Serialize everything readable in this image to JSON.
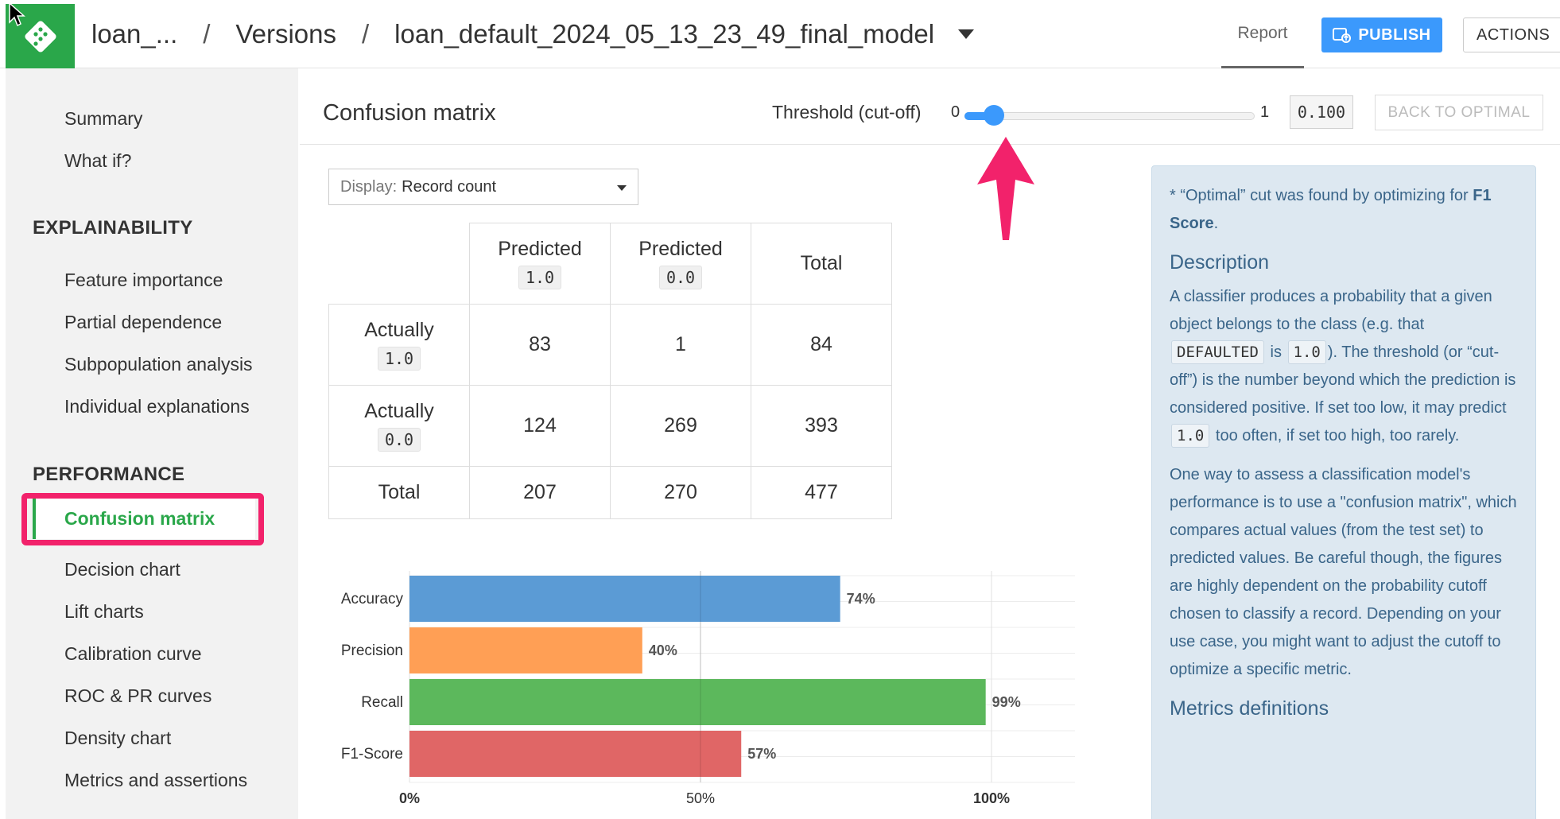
{
  "header": {
    "breadcrumb": [
      "loan_...",
      "Versions",
      "loan_default_2024_05_13_23_49_final_model"
    ],
    "separator": "/",
    "tab_report": "Report",
    "publish_label": "PUBLISH",
    "actions_label": "ACTIONS"
  },
  "sidebar": {
    "top_items": [
      "Summary",
      "What if?"
    ],
    "explainability_heading": "EXPLAINABILITY",
    "explainability_items": [
      "Feature importance",
      "Partial dependence",
      "Subpopulation analysis",
      "Individual explanations"
    ],
    "performance_heading": "PERFORMANCE",
    "active_item": "Confusion matrix",
    "performance_items": [
      "Decision chart",
      "Lift charts",
      "Calibration curve",
      "ROC & PR curves",
      "Density chart",
      "Metrics and assertions"
    ]
  },
  "main": {
    "title": "Confusion matrix",
    "threshold_label": "Threshold (cut-off)",
    "threshold_min": "0",
    "threshold_max": "1",
    "threshold_value": "0.100",
    "threshold_fraction": 0.1,
    "back_to_optimal": "BACK TO OPTIMAL",
    "display_key": "Display:",
    "display_value": "Record count"
  },
  "matrix": {
    "predicted_label": "Predicted",
    "actually_label": "Actually",
    "total_label": "Total",
    "class_pos": "1.0",
    "class_neg": "0.0",
    "tp": "83",
    "fn": "1",
    "row1_total": "84",
    "fp": "124",
    "tn": "269",
    "row2_total": "393",
    "col1_total": "207",
    "col2_total": "270",
    "grand_total": "477"
  },
  "chart_data": {
    "type": "bar",
    "orientation": "horizontal",
    "categories": [
      "Accuracy",
      "Precision",
      "Recall",
      "F1-Score"
    ],
    "values": [
      74,
      40,
      99,
      57
    ],
    "value_labels": [
      "74%",
      "40%",
      "99%",
      "57%"
    ],
    "colors": [
      "#5b9bd5",
      "#ff9f55",
      "#5cb85c",
      "#e06666"
    ],
    "xlim": [
      0,
      100
    ],
    "xticks": [
      "0%",
      "50%",
      "100%"
    ]
  },
  "info": {
    "optimal_pre": "* “Optimal” cut was found by optimizing for",
    "optimal_metric": "F1 Score",
    "optimal_post": ".",
    "description_heading": "Description",
    "desc1_a": "A classifier produces a probability that a given object belongs to the class (e.g. that",
    "desc1_code1": "DEFAULTED",
    "desc1_b": "is",
    "desc1_code2": "1.0",
    "desc1_c": "). The threshold (or “cut-off”) is the number beyond which the prediction is considered positive. If set too low, it may predict",
    "desc1_code3": "1.0",
    "desc1_d": "too often, if set too high, too rarely.",
    "desc2": "One way to assess a classification model's performance is to use a \"confusion matrix\", which compares actual values (from the test set) to predicted values. Be careful though, the figures are highly dependent on the probability cutoff chosen to classify a record. Depending on your use case, you might want to adjust the cutoff to optimize a specific metric.",
    "metrics_heading": "Metrics definitions"
  },
  "colors": {
    "brand_green": "#2aa74a",
    "primary_blue": "#3b99fc",
    "highlight_pink": "#f2226b"
  }
}
